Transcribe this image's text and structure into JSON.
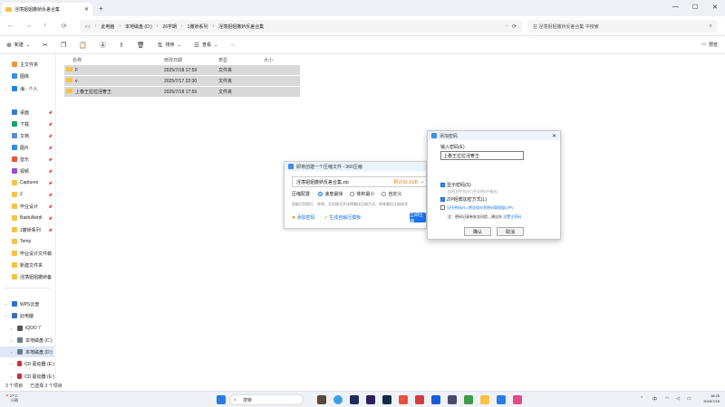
{
  "window": {
    "tab_title": "淫荡姐姐撒娇反差合集",
    "new_tab_label": "+",
    "controls": {
      "minimize": "—",
      "maximize": "☐",
      "close": "✕"
    }
  },
  "address": {
    "crumbs": [
      "此电脑",
      "本地磁盘 (D:)",
      "26学期",
      "1撒娇系列",
      "淫荡姐姐撒娇反差合集"
    ],
    "search_placeholder": "在 淫荡姐姐撒娇反差合集 中搜索"
  },
  "toolbar": {
    "new": "新建",
    "sort": "排序",
    "view": "查看",
    "more": "···",
    "preview": "预览"
  },
  "sidebar": {
    "items": [
      {
        "label": "主文件夹",
        "color": "#e89a3c",
        "pin": ""
      },
      {
        "label": "图库",
        "color": "#3a8ee6",
        "pin": ""
      },
      {
        "label": "海 - 个人",
        "color": "#1e88e5",
        "pin": ""
      },
      {
        "label": "桌面",
        "color": "#2f7fd8",
        "pin": "📌"
      },
      {
        "label": "下载",
        "color": "#1aa06b",
        "pin": "📌"
      },
      {
        "label": "文档",
        "color": "#5b8bd6",
        "pin": "📌"
      },
      {
        "label": "图片",
        "color": "#2b8ee0",
        "pin": "📌"
      },
      {
        "label": "音乐",
        "color": "#e8553c",
        "pin": "📌"
      },
      {
        "label": "视频",
        "color": "#9b4ad6",
        "pin": "📌"
      },
      {
        "label": "Captures",
        "color": "#f6c343",
        "pin": "📌"
      },
      {
        "label": "2",
        "color": "#f6c343",
        "pin": "📌"
      },
      {
        "label": "毕业设计",
        "color": "#f6c343",
        "pin": "📌"
      },
      {
        "label": "BaiduNetdi",
        "color": "#f6c343",
        "pin": "📌"
      },
      {
        "label": "1撒娇系列",
        "color": "#f6c343",
        "pin": "📌"
      },
      {
        "label": "Temp",
        "color": "#f6c343",
        "pin": ""
      },
      {
        "label": "毕业设计文件稿",
        "color": "#f6c343",
        "pin": ""
      },
      {
        "label": "新建文件夹",
        "color": "#f6c343",
        "pin": ""
      },
      {
        "label": "淫荡姐姐撒娇备",
        "color": "#f6c343",
        "pin": ""
      },
      {
        "label": "WPS云盘",
        "color": "#2f6fe0",
        "pin": ""
      },
      {
        "label": "此电脑",
        "color": "#3d6fb6",
        "pin": ""
      },
      {
        "label": "iQOO 7",
        "color": "#555555",
        "pin": ""
      },
      {
        "label": "本地磁盘 (C:)",
        "color": "#6a7c92",
        "pin": ""
      },
      {
        "label": "本地磁盘 (D:)",
        "color": "#6a7c92",
        "pin": ""
      },
      {
        "label": "CD 驱动器 (E:)",
        "color": "#c8323c",
        "pin": ""
      },
      {
        "label": "CD 驱动器 (E:)",
        "color": "#c8323c",
        "pin": ""
      }
    ]
  },
  "files": {
    "columns": [
      "名称",
      "修改日期",
      "类型",
      "大小"
    ],
    "rows": [
      {
        "name": "F",
        "date": "2025/7/18 17:59",
        "type": "文件夹",
        "size": ""
      },
      {
        "name": "v",
        "date": "2025/7/17 22:30",
        "type": "文件夹",
        "size": ""
      },
      {
        "name": "上春王拉拉淫奢王",
        "date": "2025/7/18 17:59",
        "type": "文件夹",
        "size": ""
      }
    ]
  },
  "status": {
    "count": "3 个项目",
    "selected": "已选择 3 个项目"
  },
  "compress_dialog": {
    "title": "即将创建一个压缩文件 - 360压缩",
    "filename": "淫荡姐姐撒娇反差合集.zip",
    "filesize": "预计33.1GB",
    "config_label": "压缩配置:",
    "options": [
      "速度最快",
      "体积最小",
      "自定义"
    ],
    "desc": "智能识别图片、视频、文档格式并选择最佳压缩方式，带来最佳压缩体验",
    "add_password": "添加密码",
    "self_extract": "生成自解压模板",
    "start_button": "立即压缩"
  },
  "password_dialog": {
    "title": "添加密码",
    "prompt": "输入密码(E)",
    "value": "上春王拉拉淫奢王",
    "show_password": "显示密码(S)",
    "hint_format": "加密文件名(N) (不支持ZIP格式)",
    "zip_legacy": "ZIP经典加密方式(L)",
    "remember": "记住密码(R) (将会保存到密码管理窗口中)",
    "note": "注：密码记录有安全风险，建议先",
    "note_link": "设置主密码",
    "confirm": "确认",
    "cancel": "取消"
  },
  "taskbar": {
    "weather_temp": "27°C",
    "weather_desc": "小雨",
    "search": "搜索",
    "time": "18:25",
    "date": "2025/7/18",
    "lang": "中"
  }
}
